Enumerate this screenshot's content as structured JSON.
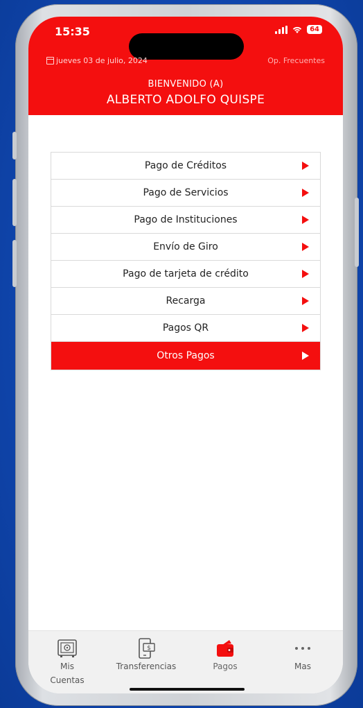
{
  "status_bar": {
    "time": "15:35",
    "battery": "64"
  },
  "header": {
    "date": "jueves 03 de julio, 2024",
    "frequent_ops": "Op. Frecuentes",
    "welcome": "BIENVENIDO (A)",
    "user_name": "ALBERTO ADOLFO QUISPE",
    "color": "#f40f0f"
  },
  "menu": {
    "items": [
      {
        "label": "Pago de Créditos"
      },
      {
        "label": "Pago de Servicios"
      },
      {
        "label": "Pago de Instituciones"
      },
      {
        "label": "Envío de Giro"
      },
      {
        "label": "Pago de tarjeta de crédito"
      },
      {
        "label": "Recarga"
      },
      {
        "label": "Pagos QR"
      },
      {
        "label": "Otros Pagos",
        "selected": true
      }
    ]
  },
  "tabbar": {
    "items": [
      {
        "label_line1": "Mis",
        "label_line2": "Cuentas",
        "icon": "safe-icon"
      },
      {
        "label_line1": "Transferencias",
        "icon": "phone-transfer-icon"
      },
      {
        "label_line1": "Pagos",
        "icon": "wallet-icon",
        "active": true
      },
      {
        "label_line1": "Mas",
        "icon": "more-dots-icon"
      }
    ]
  }
}
